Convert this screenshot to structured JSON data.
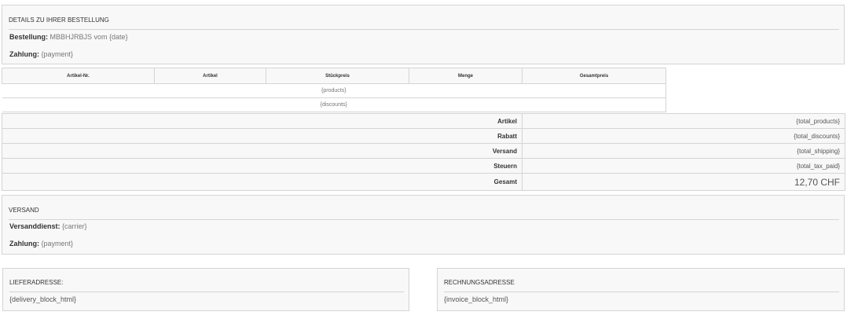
{
  "order_details": {
    "title": "DETAILS ZU IHRER BESTELLUNG",
    "order_label": "Bestellung:",
    "order_value": "MBBHJRBJS vom {date}",
    "payment_label": "Zahlung:",
    "payment_value": "{payment}"
  },
  "products_table": {
    "headers": [
      "Artikel-Nr.",
      "Artikel",
      "Stückpreis",
      "Menge",
      "Gesamtpreis"
    ],
    "products_row": "{products}",
    "discounts_row": "{discounts}"
  },
  "totals": [
    {
      "label": "Artikel",
      "value": "{total_products}"
    },
    {
      "label": "Rabatt",
      "value": "{total_discounts}"
    },
    {
      "label": "Versand",
      "value": "{total_shipping}"
    },
    {
      "label": "Steuern",
      "value": "{total_tax_paid}"
    },
    {
      "label": "Gesamt",
      "value": "12,70 CHF"
    }
  ],
  "shipping": {
    "title": "VERSAND",
    "carrier_label": "Versanddienst:",
    "carrier_value": "{carrier}",
    "payment_label": "Zahlung:",
    "payment_value": "{payment}"
  },
  "delivery_address": {
    "title": "LIEFERADRESSE:",
    "content": "{delivery_block_html}"
  },
  "invoice_address": {
    "title": "RECHNUNGSADRESSE",
    "content": "{invoice_block_html}"
  }
}
